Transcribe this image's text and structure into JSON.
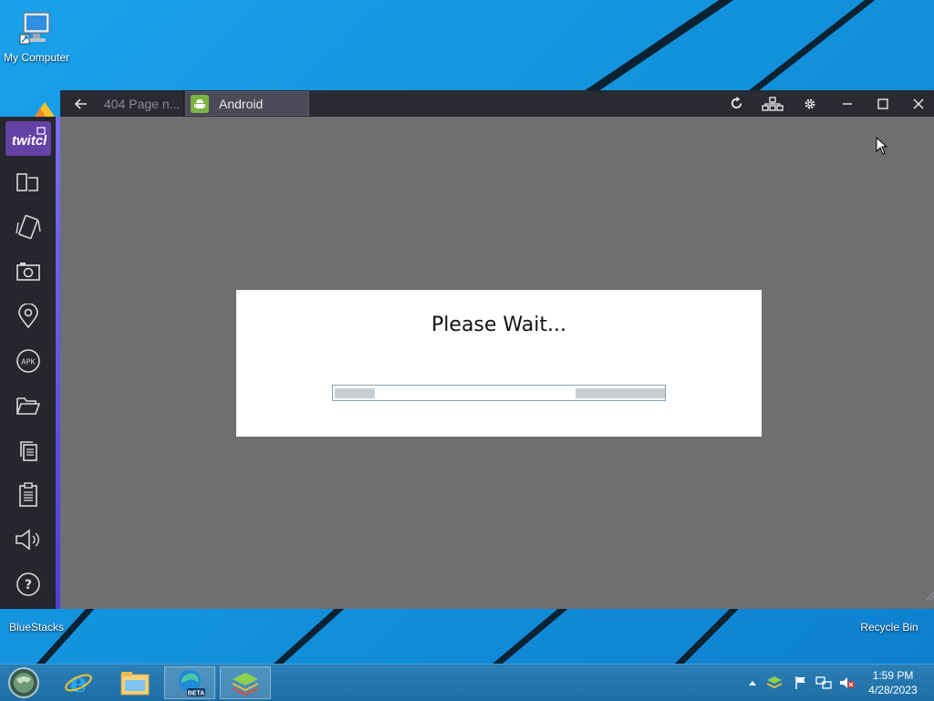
{
  "desktop": {
    "icons": [
      {
        "label": "My Computer"
      },
      {
        "label": "BlueStacks"
      },
      {
        "label": "Recycle Bin"
      }
    ]
  },
  "window": {
    "tabs": [
      {
        "label": "404 Page n..."
      },
      {
        "label": "Android",
        "icon": "android-icon"
      }
    ],
    "titlebar_controls": [
      "back-arrow-icon",
      "refresh-icon",
      "multi-instance-icon",
      "gear-icon",
      "minimize-icon",
      "maximize-icon",
      "close-icon"
    ],
    "sidebar": {
      "top_button": "twitch",
      "items": [
        "multi-window-icon",
        "shake-icon",
        "screenshot-icon",
        "location-icon",
        "apk-install-icon",
        "folder-icon",
        "copy-icon",
        "paste-icon",
        "volume-icon",
        "help-icon"
      ],
      "apk_label": "APK",
      "accent": "#6a5be8"
    }
  },
  "dialog": {
    "title": "Please Wait..."
  },
  "taskbar": {
    "apps": [
      "start-orb",
      "internet-explorer-icon",
      "file-explorer-icon",
      "edge-beta-icon",
      "bluestacks-icon"
    ],
    "edge_badge": "BETA",
    "clock_time": "1:59 PM",
    "clock_date": "4/28/2023"
  }
}
